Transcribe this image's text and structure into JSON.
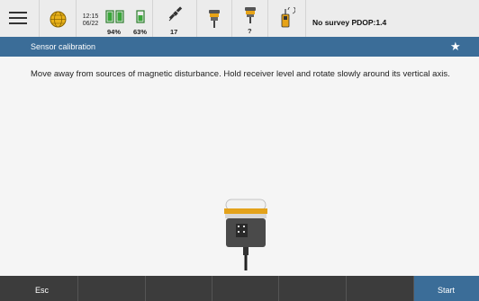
{
  "status": {
    "time": "12:15",
    "date": "06/22",
    "battery1": "94%",
    "battery2": "63%",
    "satellites": "17",
    "receiver_status": "?",
    "survey_info": "No survey  PDOP:1.4"
  },
  "header": {
    "title": "Sensor calibration"
  },
  "main": {
    "instruction": "Move away from sources of magnetic disturbance. Hold receiver level and rotate slowly around its vertical axis."
  },
  "footer": {
    "esc_label": "Esc",
    "start_label": "Start"
  },
  "colors": {
    "accent": "#3b6d98",
    "footer_bg": "#3c3c3c"
  },
  "icons": [
    "menu-icon",
    "globe-icon",
    "battery-icon",
    "satellite-icon",
    "receiver-icon",
    "controller-icon",
    "star-icon",
    "gnss-receiver-image"
  ]
}
